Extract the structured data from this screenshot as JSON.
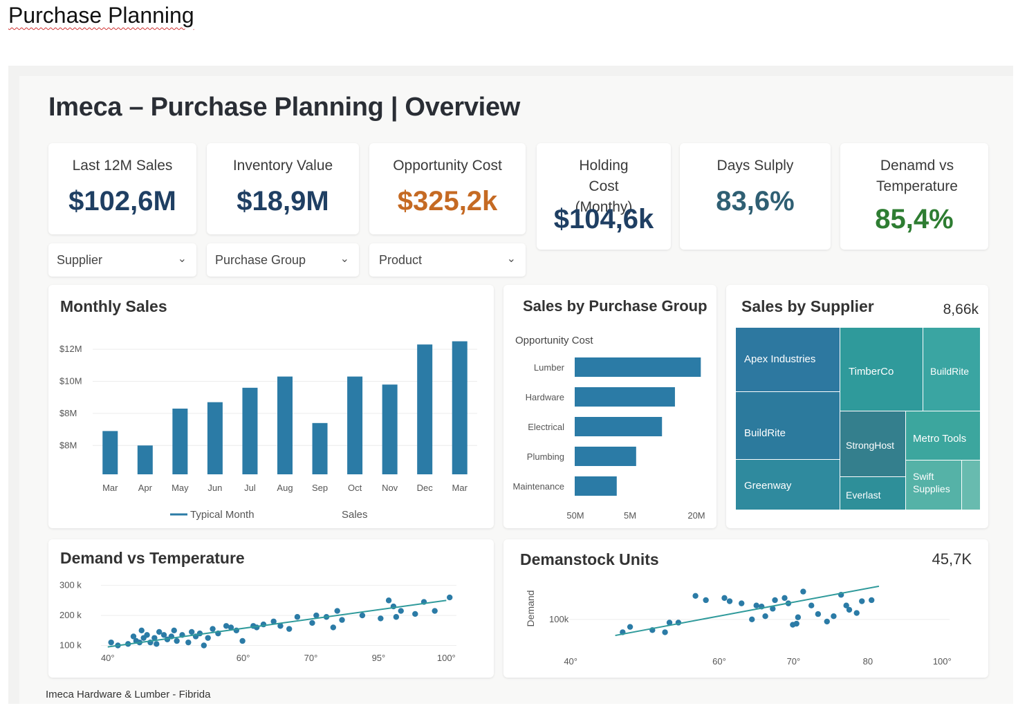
{
  "doc": {
    "title": "Purchase Planning"
  },
  "dashboard": {
    "title": "Imeca – Purchase Planning | Overview",
    "footer": "Imeca Hardware & Lumber - Fibrida"
  },
  "kpis": [
    {
      "label": "Last 12M Sales",
      "value": "$102,6M",
      "color": "#1f3f63"
    },
    {
      "label": "Inventory Value",
      "value": "$18,9M",
      "color": "#1f3f63"
    },
    {
      "label": "Opportunity Cost",
      "value": "$325,2k",
      "color": "#c56a23"
    },
    {
      "label": "Holding Cost (Monthy)",
      "value": "$104,6k",
      "color": "#1f3f63"
    },
    {
      "label": "Days Sulply",
      "value": "83,6%",
      "color": "#2f5f73"
    },
    {
      "label": "Denamd vs Temperature",
      "value": "85,4%",
      "color": "#2e7d32"
    }
  ],
  "filters": [
    {
      "label": "Supplier",
      "icon": "chevron-down-icon"
    },
    {
      "label": "Purchase Group",
      "icon": "chevron-down-icon"
    },
    {
      "label": "Product",
      "icon": "chevron-down-icon"
    }
  ],
  "colors": {
    "accent": "#2b7ba6",
    "treemap_dark": "#2d78a0",
    "treemap_teal": "#2f9a9b",
    "scatter": "#2b7ba6",
    "trend": "#2f9a9b"
  },
  "chart_data": [
    {
      "type": "bar",
      "title": "Monthly Sales",
      "categories": [
        "Mar",
        "Apr",
        "May",
        "Jun",
        "Jul",
        "Aug",
        "Sep",
        "Oct",
        "Nov",
        "Dec",
        "Mar"
      ],
      "values": [
        6.9,
        6.0,
        8.3,
        8.7,
        9.6,
        10.3,
        7.4,
        10.3,
        9.8,
        12.3,
        12.5
      ],
      "ytick_labels": [
        "$12M",
        "$10M",
        "$8M",
        "$8M"
      ],
      "yticks": [
        12,
        10,
        8,
        6
      ],
      "ylim": [
        4.2,
        13
      ],
      "legend": [
        "Typical Month",
        "Sales"
      ],
      "grid": true
    },
    {
      "type": "bar",
      "orientation": "horizontal",
      "title": "Sales by Purchase Group",
      "subtitle": "Opportunity Cost",
      "categories": [
        "Lumber",
        "Hardware",
        "Electrical",
        "Plumbing",
        "Maintenance"
      ],
      "values": [
        19.5,
        15.5,
        13.5,
        9.5,
        6.5
      ],
      "xtick_labels": [
        "50M",
        "5M",
        "20M"
      ],
      "xlim": [
        0,
        20
      ]
    },
    {
      "type": "treemap",
      "title": "Sales by Supplier",
      "total": "8,66k",
      "items": [
        {
          "name": "Apex Industries",
          "value": 14
        },
        {
          "name": "TimberCo",
          "value": 11
        },
        {
          "name": "BuildRite",
          "value": 7
        },
        {
          "name": "BuildRite",
          "value": 13
        },
        {
          "name": "Greenway",
          "value": 10
        },
        {
          "name": "StrongHost",
          "value": 6
        },
        {
          "name": "Everlast",
          "value": 3
        },
        {
          "name": "Metro Tools",
          "value": 5
        },
        {
          "name": "Swift Supplies",
          "value": 4
        }
      ]
    },
    {
      "type": "scatter",
      "title": "Demand vs Temperature",
      "xtick_labels": [
        "40°",
        "60°",
        "70°",
        "95°",
        "100°"
      ],
      "xticks": [
        40,
        60,
        70,
        80,
        90
      ],
      "ytick_labels": [
        "300 k",
        "200 k",
        "100 k"
      ],
      "yticks": [
        300,
        200,
        100
      ],
      "xlim": [
        39,
        91.5
      ],
      "ylim": [
        85,
        320
      ],
      "trend": [
        [
          40,
          95
        ],
        [
          90,
          250
        ]
      ],
      "x": [
        40.5,
        41.5,
        43,
        43.8,
        44.2,
        44.7,
        45,
        45.3,
        45.8,
        46.3,
        46.9,
        47.2,
        47.6,
        48.3,
        48.8,
        49.4,
        49.8,
        50.2,
        51,
        51.9,
        52.4,
        53,
        53.6,
        54.2,
        54.8,
        55.5,
        56.3,
        57.5,
        58.2,
        59,
        59.9,
        61.5,
        62,
        63,
        64.5,
        65.5,
        66.8,
        68,
        70.2,
        70.8,
        72.3,
        73.3,
        73.9,
        74.6,
        77.6,
        80.3,
        81.5,
        82.2,
        82.6,
        83.3,
        85.4,
        86.7,
        88.3,
        90.5
      ],
      "y": [
        110,
        100,
        105,
        130,
        115,
        110,
        150,
        125,
        135,
        110,
        125,
        105,
        145,
        135,
        120,
        130,
        150,
        115,
        135,
        110,
        145,
        130,
        140,
        100,
        125,
        155,
        140,
        165,
        160,
        150,
        115,
        165,
        160,
        170,
        180,
        165,
        155,
        195,
        175,
        200,
        195,
        160,
        215,
        185,
        200,
        190,
        250,
        230,
        195,
        215,
        205,
        245,
        215,
        260
      ]
    },
    {
      "type": "scatter",
      "title": "Demanstock Units",
      "ylabel": "Demand",
      "total": "45,7K",
      "xtick_labels": [
        "40°",
        "60°",
        "70°",
        "80",
        "100°"
      ],
      "xticks": [
        40,
        60,
        70,
        80,
        90
      ],
      "ytick_labels": [
        "100k"
      ],
      "yticks": [
        100
      ],
      "xlim": [
        39.8,
        91
      ],
      "ylim": [
        65,
        149
      ],
      "trend": [
        [
          46,
          85
        ],
        [
          81.5,
          131
        ]
      ],
      "x": [
        47,
        48,
        51,
        52.7,
        53.3,
        54.5,
        56.8,
        58.2,
        60.7,
        61.4,
        63,
        64.4,
        65,
        65.7,
        66.2,
        67.2,
        67.5,
        68.8,
        69.3,
        69.9,
        70.4,
        70.6,
        71.3,
        72.4,
        73.3,
        74.5,
        75.4,
        76.4,
        77.1,
        77.5,
        78.5,
        79.2,
        80.5
      ],
      "y": [
        88,
        93,
        90,
        88,
        97,
        97,
        122,
        118,
        120,
        117,
        115,
        100,
        113,
        112,
        103,
        110,
        118,
        120,
        115,
        95,
        96,
        102,
        126,
        113,
        105,
        98,
        103,
        123,
        113,
        109,
        106,
        117,
        118
      ]
    }
  ]
}
